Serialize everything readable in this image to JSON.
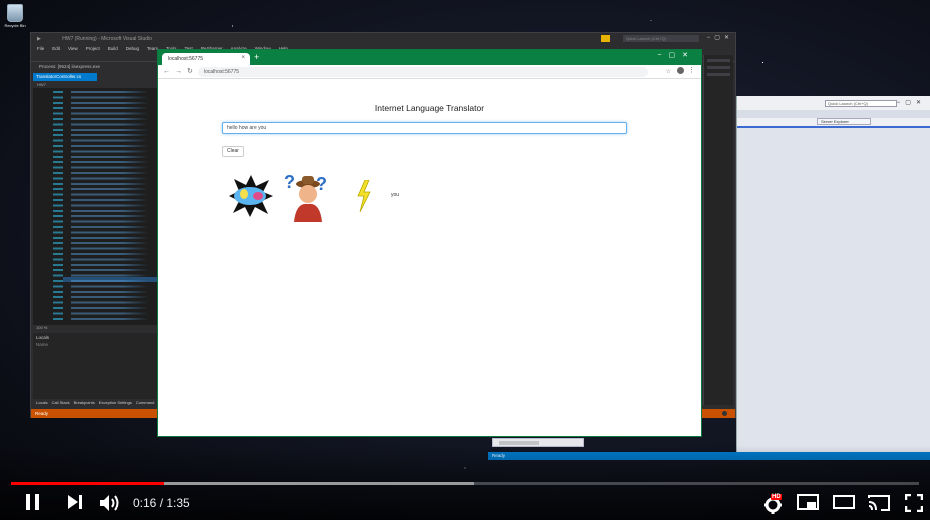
{
  "desktop": {
    "recycle_bin_label": "Recycle Bin"
  },
  "vs": {
    "title": "HW7 (Running) - Microsoft Visual Studio",
    "quick_launch": "Quick Launch (Ctrl+Q)",
    "menu": [
      "File",
      "Edit",
      "View",
      "Project",
      "Build",
      "Debug",
      "Team",
      "Tools",
      "Test",
      "ReSharper",
      "Analyze",
      "Window",
      "Help"
    ],
    "process_label": "Process: [9524] iisexpress.exe",
    "editor_tab": "TranslatorController.cs",
    "nav_label": "HW7",
    "zoom": "100 %",
    "locals_title": "Locals",
    "locals_sub": "Name",
    "bottom_tabs": [
      "Locals",
      "Call Stack",
      "Breakpoints",
      "Exception Settings",
      "Command"
    ],
    "status": "Ready"
  },
  "vs2": {
    "quick_launch": "Quick Launch (Ctrl+Q)",
    "tab": "Server Explorer",
    "status": "Ready"
  },
  "chrome": {
    "tab_title": "localhost:56775",
    "url": "localhost:56775",
    "page_title": "Internet Language Translator",
    "input_value": "hello how are you",
    "clear_label": "Clear",
    "output_word": "you",
    "images": [
      "hello-sticker",
      "how-cowboy-confused",
      "are-lightning-bolt"
    ]
  },
  "player": {
    "current_time": "0:16",
    "duration": "1:35",
    "time_text": "0:16 / 1:35",
    "progress": 0.168,
    "buffered": 0.51,
    "hd_badge": "HD"
  },
  "colors": {
    "vs_status": "#ca5100",
    "vs2_status": "#007acc",
    "chrome_frame": "#0b8043",
    "progress_red": "#ff0000"
  }
}
